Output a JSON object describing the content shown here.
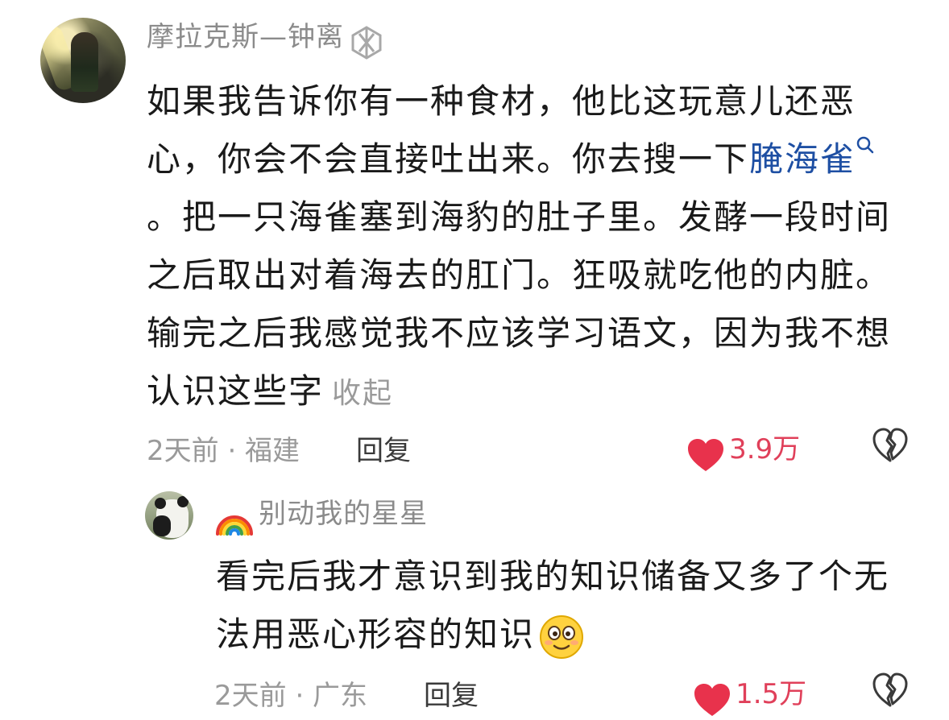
{
  "comment1": {
    "username": "摩拉克斯—钟离",
    "badge_icon": "badge-icon",
    "text_part1": "如果我告诉你有一种食材，他比这玩意儿还恶心，你会不会直接吐出来。你去搜一下",
    "link_text": "腌海雀",
    "text_part2": "。把一只海雀塞到海豹的肚子里。发酵一段时间之后取出对着海去的肛门。狂吸就吃他的内脏。输完之后我感觉我不应该学习语文，因为我不想认识这些字",
    "collapse_label": "收起",
    "time_location": "2天前 · 福建",
    "reply_label": "回复",
    "like_count": "3.9万",
    "like_color": "#e8324c"
  },
  "comment2": {
    "username": "别动我的星星",
    "rainbow_icon": "rainbow-icon",
    "text": "看完后我才意识到我的知识储备又多了个无法用恶心形容的知识",
    "emoji_icon": "smiling-face-icon",
    "time_location": "2天前 · 广东",
    "reply_label": "回复",
    "like_count": "1.5万",
    "like_color": "#e8324c"
  }
}
